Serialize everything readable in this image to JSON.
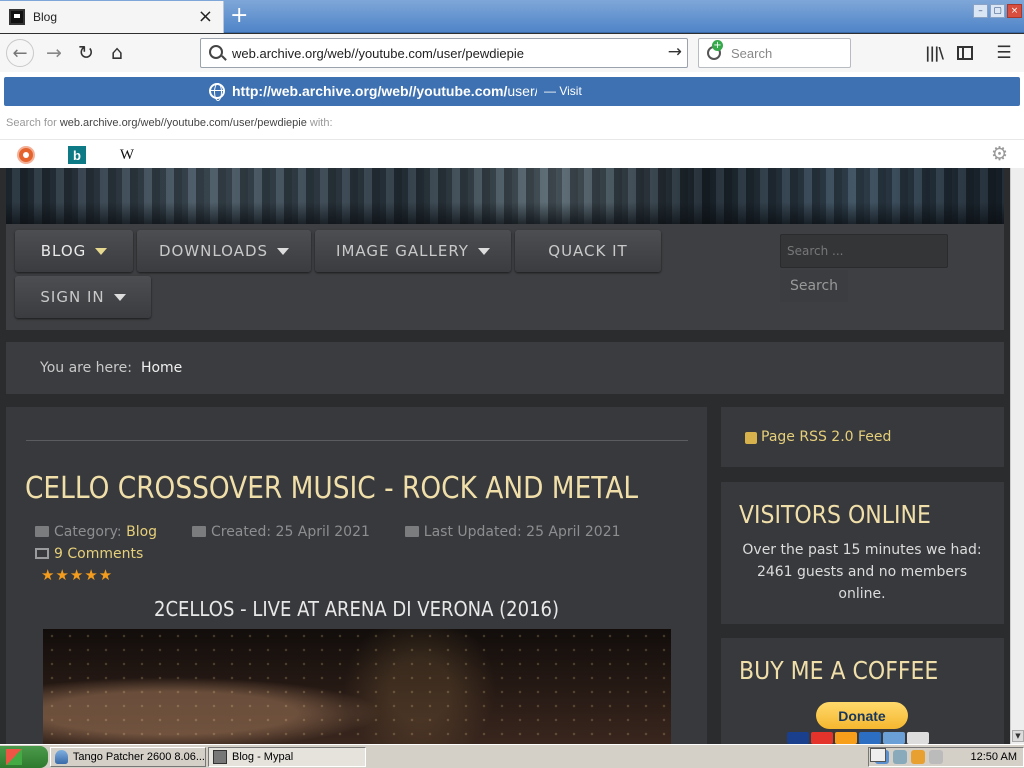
{
  "browser": {
    "tab_title": "Blog",
    "tab_close": "×",
    "new_tab": "+",
    "url": "web.archive.org/web//youtube.com/user/pewdiepie",
    "search_placeholder": "Search",
    "window_controls": [
      "–",
      "▢",
      "×"
    ]
  },
  "url_dropdown": {
    "suggestion_bold": "http://web.archive.org/web//youtube.com/",
    "suggestion_rest": "user/pewdiepie",
    "suggestion_action": "— Visit",
    "search_for_prefix": "Search for",
    "search_for_query": "web.archive.org/web//youtube.com/user/pewdiepie",
    "search_for_suffix": "with:",
    "engines": [
      "duckduckgo-icon",
      "bing-icon",
      "wikipedia-icon"
    ],
    "bing_glyph": "b",
    "wikipedia_glyph": "W"
  },
  "site": {
    "menu": {
      "blog": "BLOG",
      "downloads": "DOWNLOADS",
      "gallery": "IMAGE GALLERY",
      "quack": "QUACK IT",
      "signin": "SIGN IN"
    },
    "search_placeholder": "Search ...",
    "search_button": "Search",
    "breadcrumb_prefix": "You are here:",
    "breadcrumb_home": "Home"
  },
  "article": {
    "title": "CELLO CROSSOVER MUSIC - ROCK AND METAL",
    "category_label": "Category:",
    "category_value": "Blog",
    "created": "Created: 25 April 2021",
    "updated": "Last Updated: 25 April 2021",
    "comments": "9 Comments",
    "rating": 5,
    "rating_stars": "★★★★★",
    "video_title": "2CELLOS - LIVE AT ARENA DI VERONA (2016)"
  },
  "sidebar": {
    "rss": "Page RSS 2.0 Feed",
    "visitors_title": "VISITORS ONLINE",
    "visitors_text": "Over the past 15 minutes we had: 2461 guests and no members online.",
    "coffee_title": "BUY ME A COFFEE",
    "donate": "Donate",
    "cards": [
      "#1a3f8c",
      "#e4332b",
      "#f79e1b",
      "#2c6fc2",
      "#6aa0d6",
      "#ddd"
    ]
  },
  "taskbar": {
    "tango": "Tango Patcher 2600 8.06...",
    "browser": "Blog - Mypal",
    "clock": "12:50 AM"
  },
  "colors": {
    "accent_gold": "#f1dfaa",
    "link_gold": "#e6cf7a",
    "suggest_blue": "#3e71b1"
  }
}
